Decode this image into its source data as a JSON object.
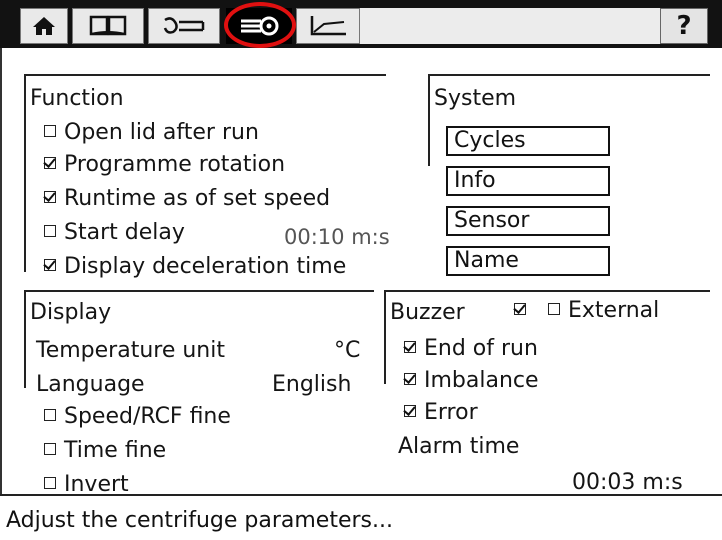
{
  "tabs": {
    "help_label": "?"
  },
  "function": {
    "title": "Function",
    "items": [
      {
        "label": "Open lid after run",
        "checked": false
      },
      {
        "label": "Programme rotation",
        "checked": true
      },
      {
        "label": "Runtime as of set speed",
        "checked": true
      },
      {
        "label": "Start delay",
        "checked": false,
        "value": "00:10 m:s"
      },
      {
        "label": "Display deceleration time",
        "checked": true
      }
    ]
  },
  "system": {
    "title": "System",
    "buttons": [
      "Cycles",
      "Info",
      "Sensor",
      "Name"
    ]
  },
  "display": {
    "title": "Display",
    "temperature_label": "Temperature unit",
    "temperature_value": "°C",
    "language_label": "Language",
    "language_value": "English",
    "options": [
      {
        "label": "Speed/RCF fine",
        "checked": false
      },
      {
        "label": "Time fine",
        "checked": false
      },
      {
        "label": "Invert",
        "checked": false
      }
    ]
  },
  "buzzer": {
    "title": "Buzzer",
    "external_label": "External",
    "buzzer_checked": true,
    "external_checked": false,
    "items": [
      {
        "label": "End of run",
        "checked": true
      },
      {
        "label": "Imbalance",
        "checked": true
      },
      {
        "label": "Error",
        "checked": true
      }
    ],
    "alarm_label": "Alarm time",
    "alarm_value": "00:03 m:s"
  },
  "status": {
    "message": "Adjust the centrifuge parameters..."
  }
}
